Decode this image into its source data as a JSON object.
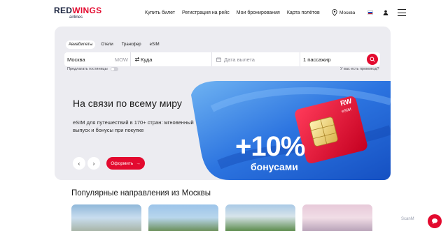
{
  "logo": {
    "text_a": "RED",
    "text_b": "WINGS",
    "sub": "airlines"
  },
  "nav": [
    "Купить билет",
    "Регистрация на рейс",
    "Мои бронирования",
    "Карта полётов"
  ],
  "header": {
    "city": "Москва"
  },
  "colors": {
    "brand_red": "#e30a2f",
    "panel_bg": "#ececf1",
    "banner_blue": "#1d63d8"
  },
  "booking": {
    "tabs": [
      "Авиабилеты",
      "Отели",
      "Трансфер",
      "eSIM"
    ],
    "active_tab": "Авиабилеты",
    "from_value": "Москва",
    "from_code": "MOW",
    "to_value": "Куда",
    "date_placeholder": "Дата вылета",
    "passengers": "1 пассажир",
    "suggest_hotels": "Предлагать гостиницы",
    "promo_link": "У вас есть промокод?"
  },
  "promo": {
    "title": "На связи по всему миру",
    "text": "eSIM для путешествий в 170+ стран: мгновенный выпуск и бонусы при покупке",
    "order_label": "Оформить",
    "banner_big": "+10%",
    "banner_sub": "бонусами",
    "sim_label_a": "RW",
    "sim_label_b": "eSIM"
  },
  "popular": {
    "title": "Популярные направления из Москвы"
  },
  "widget": {
    "scan_label": "ScanM"
  },
  "icons": [
    "location-pin-icon",
    "russia-flag-icon",
    "user-icon",
    "menu-icon",
    "swap-icon",
    "calendar-icon",
    "search-icon",
    "chevron-left-icon",
    "chevron-right-icon",
    "arrow-right-icon",
    "chat-icon"
  ]
}
